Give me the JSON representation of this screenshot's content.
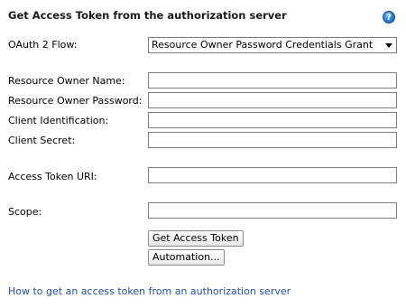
{
  "dialog": {
    "title": "Get Access Token from the authorization server",
    "help_glyph": "?"
  },
  "form": {
    "flow_label": "OAuth 2 Flow:",
    "flow_value": "Resource Owner Password Credentials Grant",
    "resource_owner_name_label": "Resource Owner Name:",
    "resource_owner_name_value": "",
    "resource_owner_password_label": "Resource Owner Password:",
    "resource_owner_password_value": "",
    "client_id_label": "Client Identification:",
    "client_id_value": "",
    "client_secret_label": "Client Secret:",
    "client_secret_value": "",
    "access_token_uri_label": "Access Token URI:",
    "access_token_uri_value": "",
    "scope_label": "Scope:",
    "scope_value": ""
  },
  "buttons": {
    "get_token": "Get Access Token",
    "automation": "Automation..."
  },
  "footer": {
    "help_link": "How to get an access token from an authorization server"
  },
  "colors": {
    "link": "#1f4fa8",
    "help_icon": "#2b7fd3"
  },
  "icons": {
    "help": "help-icon",
    "dropdown": "chevron-down-icon"
  }
}
